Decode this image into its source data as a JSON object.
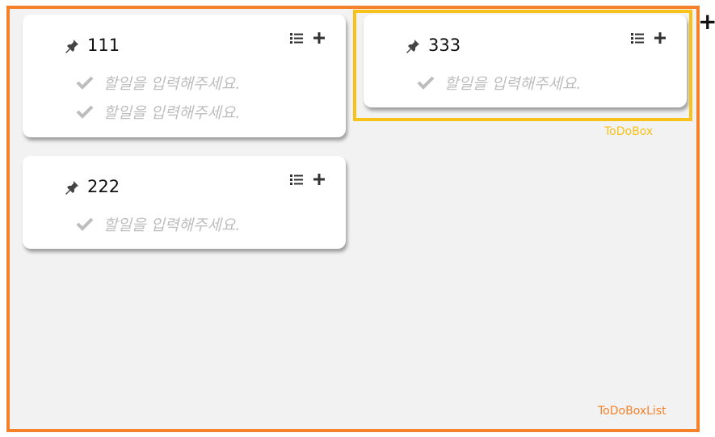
{
  "todo_box_list": {
    "label": "ToDoBoxList",
    "highlight_color": "#f5822a",
    "add_button_label": "+"
  },
  "todo_box_annotation": {
    "label": "ToDoBox",
    "highlight_color": "#f8c21a"
  },
  "cards": [
    {
      "title": "111",
      "items": [
        "할일을 입력해주세요.",
        "할일을 입력해주세요."
      ]
    },
    {
      "title": "222",
      "items": [
        "할일을 입력해주세요."
      ]
    },
    {
      "title": "333",
      "items": [
        "할일을 입력해주세요."
      ]
    }
  ],
  "icons": {
    "pin": "pushpin-icon",
    "list": "list-icon",
    "add": "plus-icon",
    "check": "check-icon"
  }
}
